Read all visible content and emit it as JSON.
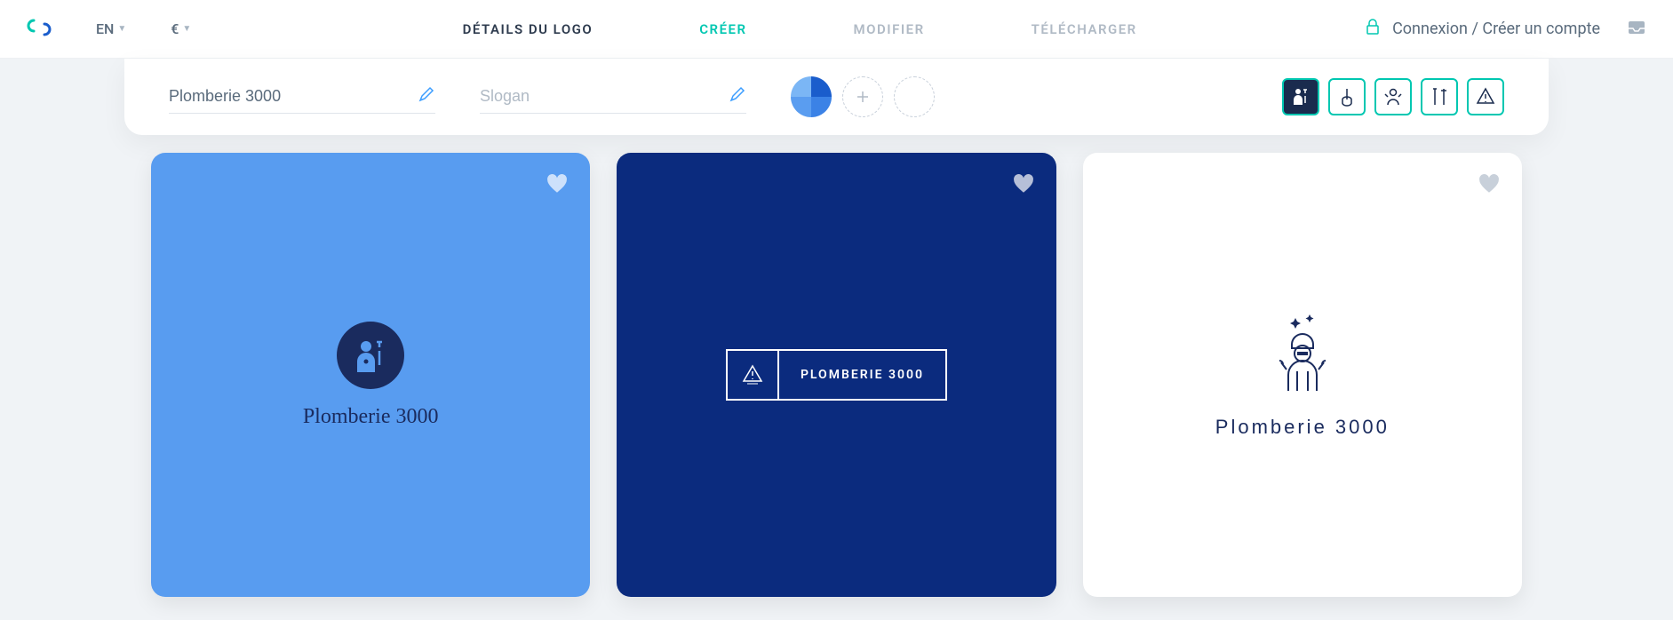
{
  "header": {
    "language": "EN",
    "currency": "€",
    "nav": {
      "details": "DÉTAILS DU LOGO",
      "create": "CRÉER",
      "modify": "MODIFIER",
      "download": "TÉLÉCHARGER"
    },
    "login": "Connexion / Créer un compte"
  },
  "toolbar": {
    "company_value": "Plomberie 3000",
    "slogan_placeholder": "Slogan"
  },
  "cards": {
    "card1_title": "Plomberie 3000",
    "card2_title": "PLOMBERIE 3000",
    "card3_title": "Plomberie 3000"
  },
  "colors": {
    "blue_light": "#589cf0",
    "blue_dark": "#0b2b7e",
    "teal": "#00c7b1"
  }
}
